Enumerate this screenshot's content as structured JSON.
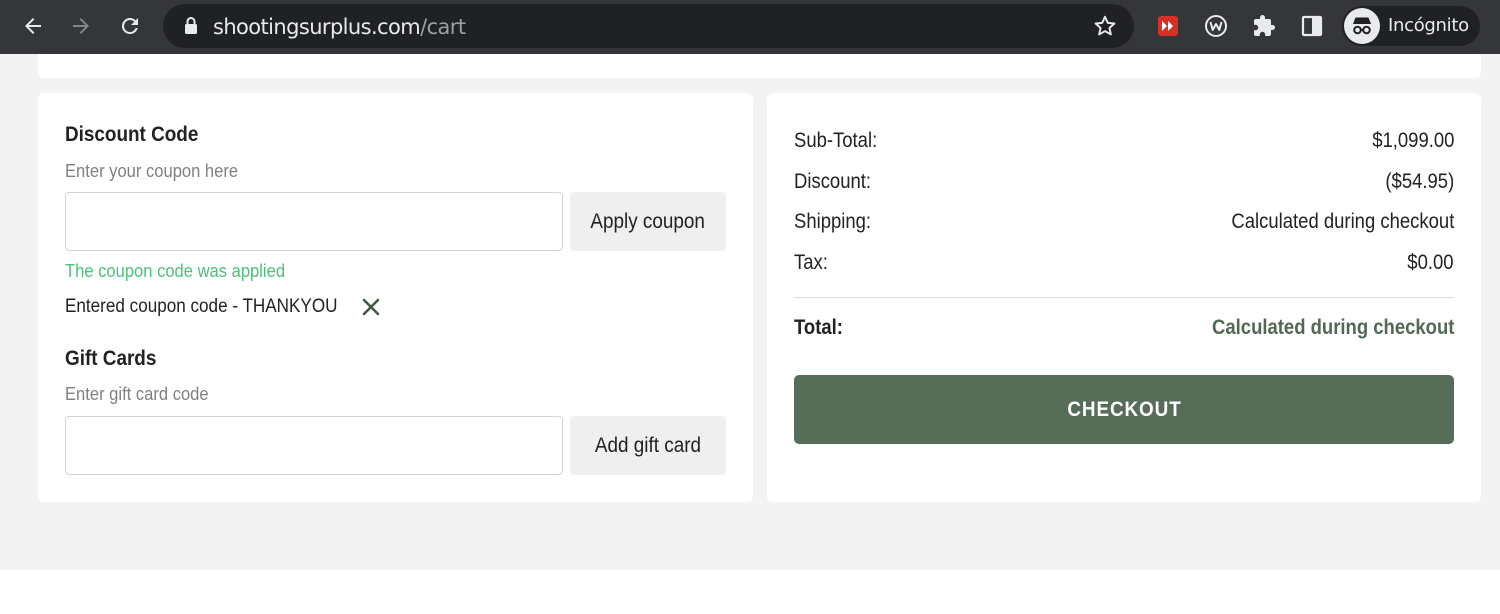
{
  "browser": {
    "url_host": "shootingsurplus.com",
    "url_path": "/cart",
    "profile_label": "Incógnito"
  },
  "discount": {
    "title": "Discount Code",
    "hint": "Enter your coupon here",
    "input_value": "",
    "apply_label": "Apply coupon",
    "applied_message": "The coupon code was applied",
    "entered_text": "Entered coupon code - THANKYOU"
  },
  "gift": {
    "title": "Gift Cards",
    "hint": "Enter gift card code",
    "input_value": "",
    "add_label": "Add gift card"
  },
  "summary": {
    "subtotal_label": "Sub-Total:",
    "subtotal_value": "$1,099.00",
    "discount_label": "Discount:",
    "discount_value": "($54.95)",
    "shipping_label": "Shipping:",
    "shipping_value": "Calculated during checkout",
    "tax_label": "Tax:",
    "tax_value": "$0.00",
    "total_label": "Total:",
    "total_value": "Calculated during checkout",
    "checkout_label": "CHECKOUT"
  },
  "colors": {
    "brand_green": "#566e57",
    "total_green": "#4f6a51",
    "success_green": "#4cc17a",
    "browser_chrome": "#35363a"
  },
  "icons": [
    "back-icon",
    "forward-icon",
    "reload-icon",
    "lock-icon",
    "star-icon",
    "extension-icon",
    "extension-w-icon",
    "puzzle-icon",
    "side-panel-icon",
    "incognito-icon",
    "close-icon"
  ]
}
